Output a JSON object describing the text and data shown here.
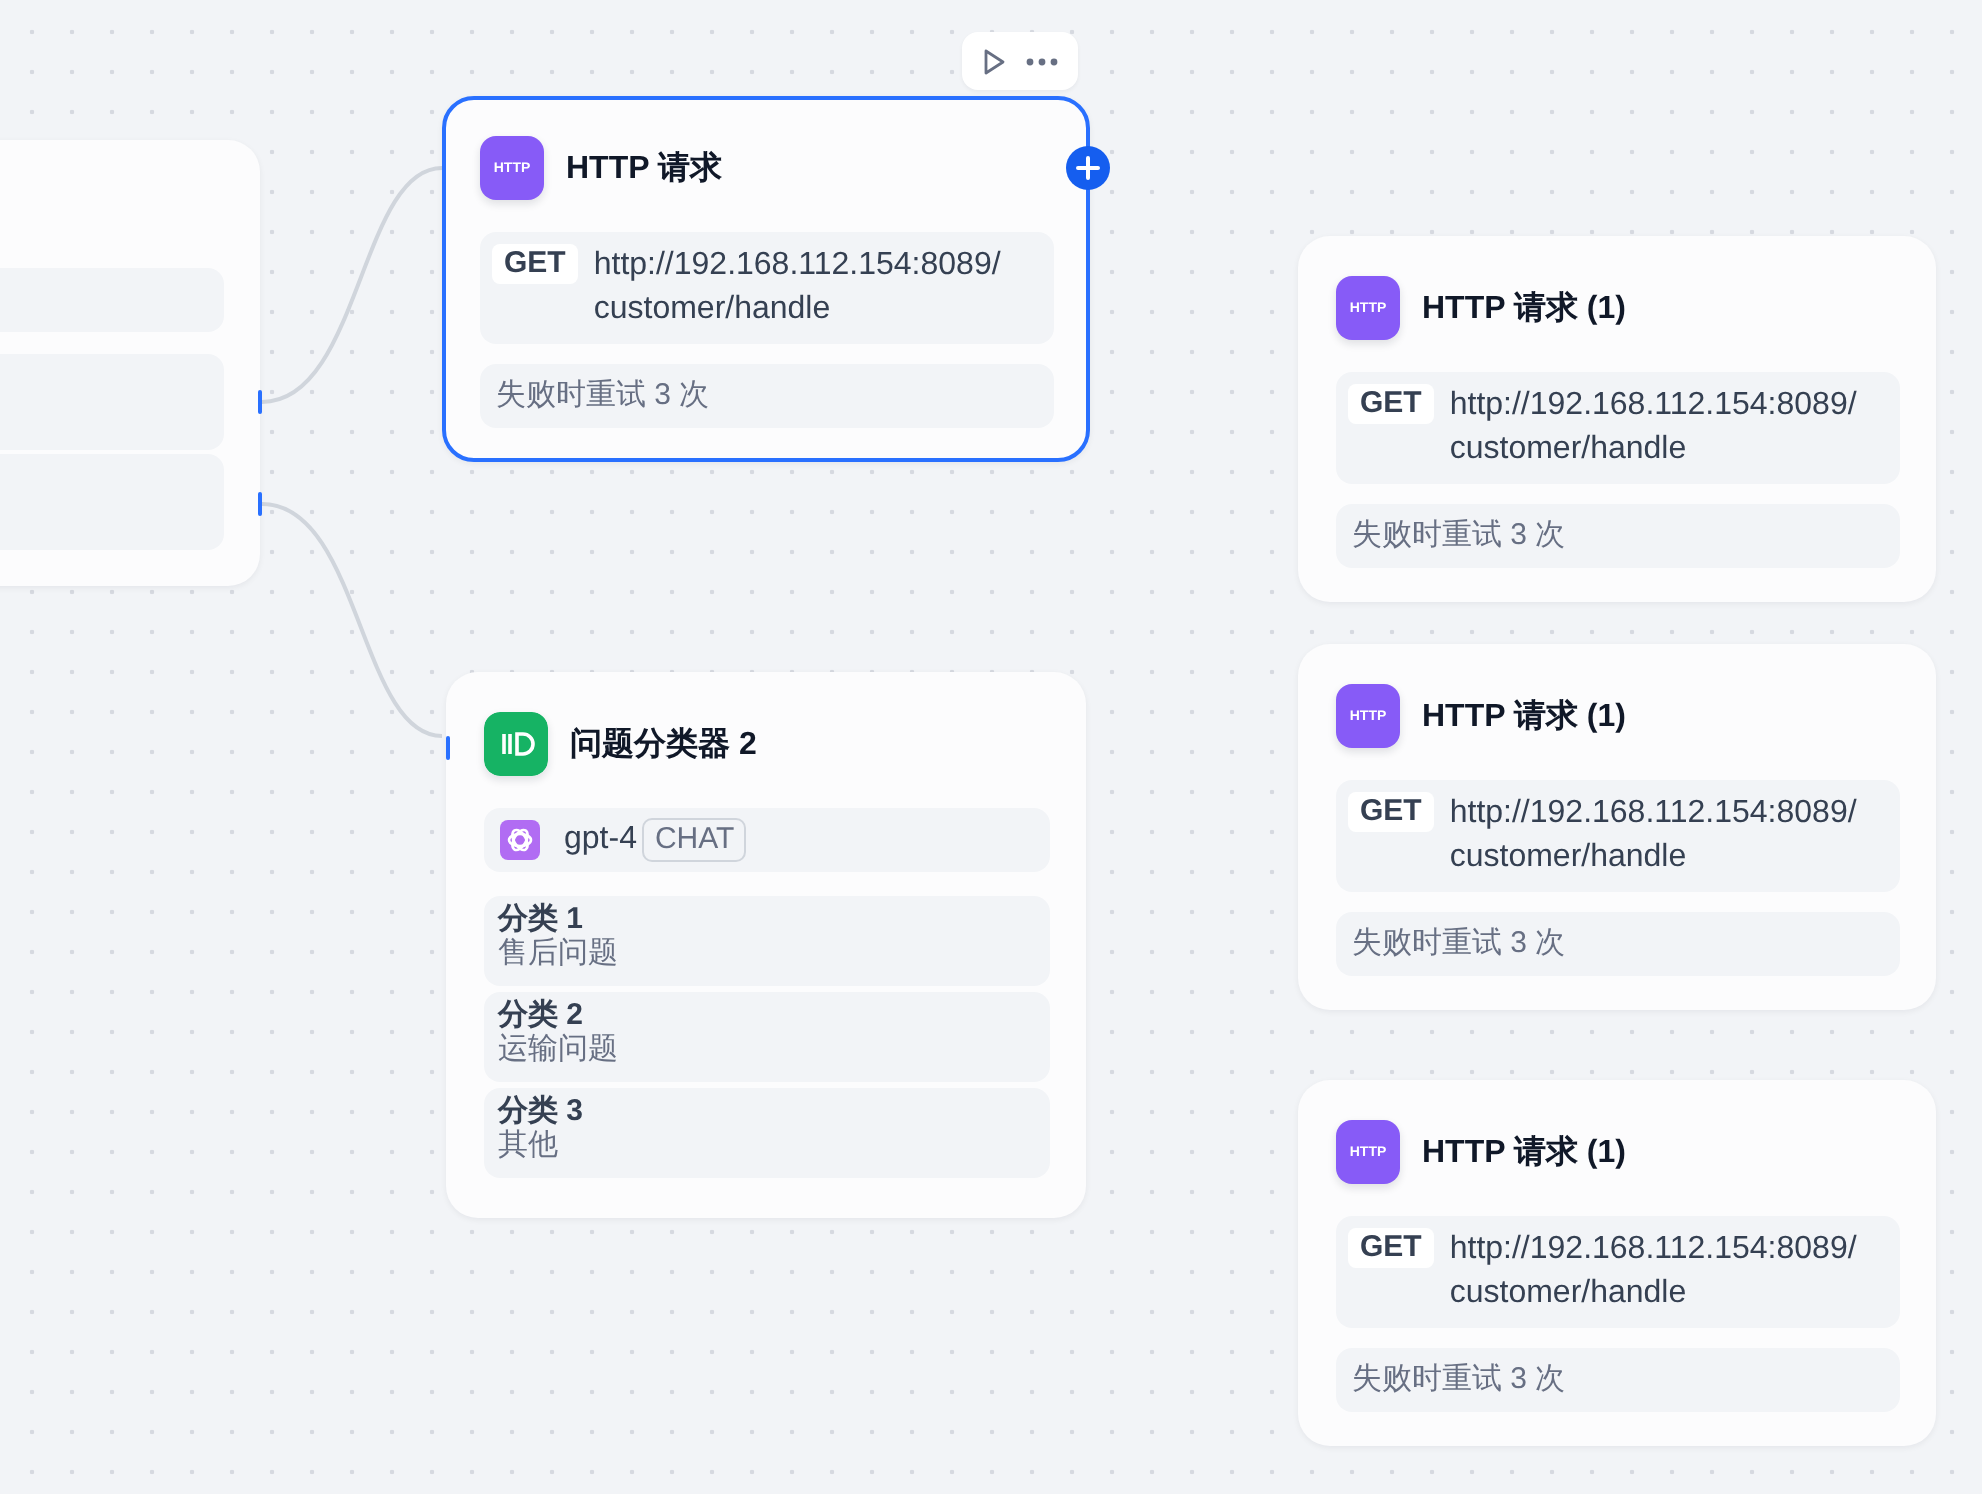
{
  "nodes": [
    {
      "kind": "http",
      "icon_text": "HTTP",
      "title": "HTTP 请求",
      "selected": true,
      "method": "GET",
      "url_lines": [
        "http://192.168.112.154:8089/",
        "customer/handle"
      ],
      "retry": "失败时重试 3 次"
    },
    {
      "kind": "classifier",
      "title": "问题分类器 2",
      "selected": false,
      "model": "gpt-4",
      "model_tag": "CHAT",
      "classes": [
        {
          "title": "分类 1",
          "desc": "售后问题"
        },
        {
          "title": "分类 2",
          "desc": "运输问题"
        },
        {
          "title": "分类 3",
          "desc": "其他"
        }
      ]
    },
    {
      "kind": "http",
      "icon_text": "HTTP",
      "title": "HTTP 请求 (1)",
      "selected": false,
      "method": "GET",
      "url_lines": [
        "http://192.168.112.154:8089/",
        "customer/handle"
      ],
      "retry": "失败时重试 3 次"
    },
    {
      "kind": "http",
      "icon_text": "HTTP",
      "title": "HTTP 请求 (1)",
      "selected": false,
      "method": "GET",
      "url_lines": [
        "http://192.168.112.154:8089/",
        "customer/handle"
      ],
      "retry": "失败时重试 3 次"
    },
    {
      "kind": "http",
      "icon_text": "HTTP",
      "title": "HTTP 请求 (1)",
      "selected": false,
      "method": "GET",
      "url_lines": [
        "http://192.168.112.154:8089/",
        "customer/handle"
      ],
      "retry": "失败时重试 3 次"
    }
  ]
}
